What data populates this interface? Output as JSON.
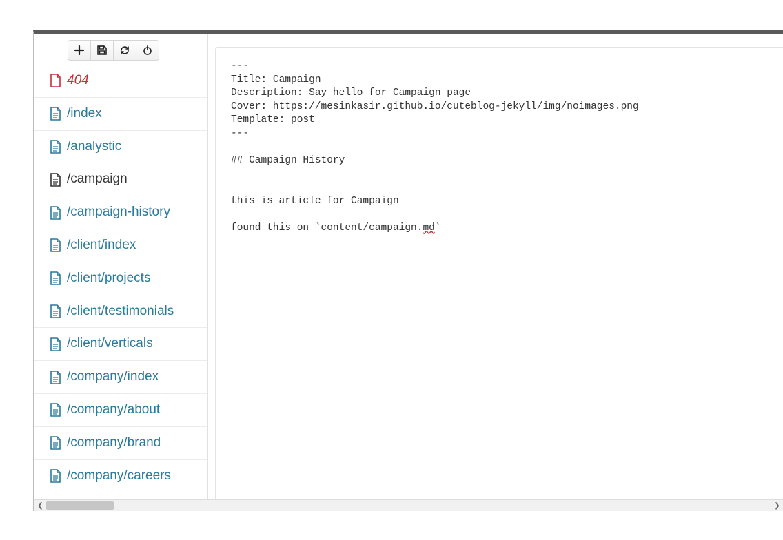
{
  "toolbar": {
    "buttons": [
      "new",
      "save",
      "refresh",
      "power"
    ]
  },
  "sidebar": {
    "items": [
      {
        "label": "404",
        "state": "error"
      },
      {
        "label": "/index",
        "state": "normal"
      },
      {
        "label": "/analystic",
        "state": "normal"
      },
      {
        "label": "/campaign",
        "state": "active"
      },
      {
        "label": "/campaign-history",
        "state": "normal"
      },
      {
        "label": "/client/index",
        "state": "normal"
      },
      {
        "label": "/client/projects",
        "state": "normal"
      },
      {
        "label": "/client/testimonials",
        "state": "normal"
      },
      {
        "label": "/client/verticals",
        "state": "normal"
      },
      {
        "label": "/company/index",
        "state": "normal"
      },
      {
        "label": "/company/about",
        "state": "normal"
      },
      {
        "label": "/company/brand",
        "state": "normal"
      },
      {
        "label": "/company/careers",
        "state": "normal"
      }
    ]
  },
  "editor": {
    "lines": [
      "---",
      "Title: Campaign",
      "Description: Say hello for Campaign page",
      "Cover: https://mesinkasir.github.io/cuteblog-jekyll/img/noimages.png",
      "Template: post",
      "---",
      "",
      "## Campaign History",
      "",
      "",
      "this is article for Campaign",
      "",
      "found this on `content/campaign.md`"
    ],
    "squiggle_token": "md"
  }
}
